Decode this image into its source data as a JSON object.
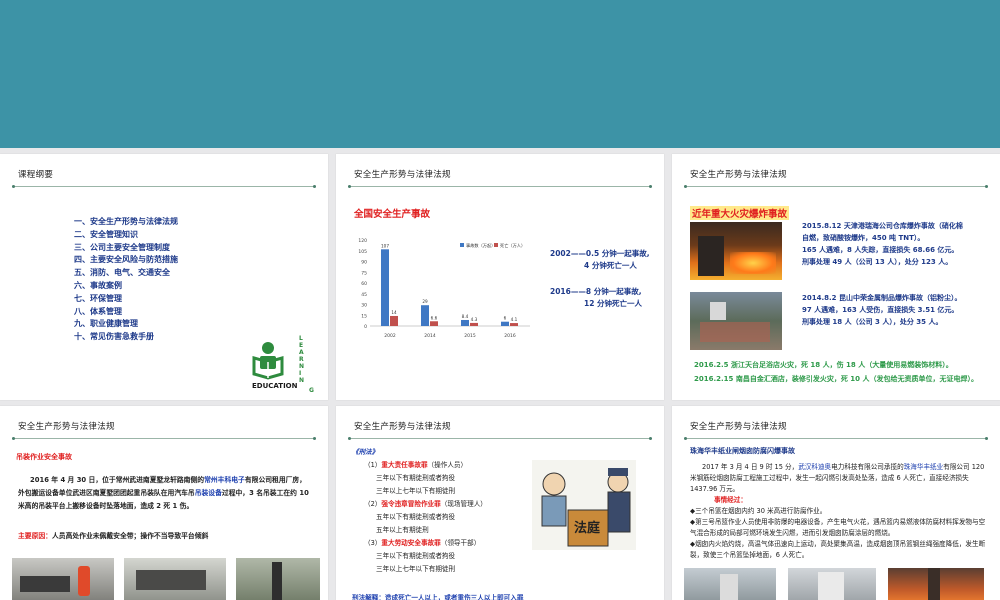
{
  "slides": {
    "toc": {
      "title": "课程纲要",
      "items": [
        "一、安全生产形势与法律法规",
        "二、安全管理知识",
        "三、公司主要安全管理制度",
        "四、主要安全风险与防范措施",
        "五、消防、电气、交通安全",
        "六、事故案例",
        "七、环保管理",
        "八、体系管理",
        "九、职业健康管理",
        "十、常见伤害急救手册"
      ],
      "logo_text": "EDUCATION",
      "logo_vertical": "LEARNING"
    },
    "national": {
      "title": "安全生产形势与法律法规",
      "heading": "全国安全生产事故",
      "stat1_line1": "2002——0.5 分钟一起事故,",
      "stat1_line2": "4 分钟死亡一人",
      "stat2_line1": "2016——8 分钟一起事故,",
      "stat2_line2": "12 分钟死亡一人"
    },
    "fire": {
      "title": "安全生产形势与法律法规",
      "heading": "近年重大火灾爆炸事故",
      "case1": [
        "2015.8.12 天津港瑞海公司仓库爆炸事故（硝化棉",
        "自燃，致硝酸铵爆炸，450 吨 TNT）。",
        "165 人遇难，8 人失踪，直接损失 68.66 亿元。",
        "刑事处理 49 人（公司 13 人），处分 123 人。"
      ],
      "case2": [
        "2014.8.2 昆山中荣金属制品爆炸事故（铝粉尘）。",
        "97 人遇难，163 人受伤，直接损失 3.51 亿元。",
        "刑事处理 18 人（公司 3 人），处分 35 人。"
      ],
      "note1": "2016.2.5 浙江天台足浴店火灾，死 18 人，伤 18 人（大量使用易燃装饰材料）。",
      "note2": "2016.2.15 南昌自金汇酒店，装修引发火灾，死 10 人（发包给无资质单位，无证电焊）。"
    },
    "crane": {
      "title": "安全生产形势与法律法规",
      "heading": "吊装作业安全事故",
      "p1_a": "2016 年 4 月 30 日，位于常州武进南夏墅龙轩路南侧的",
      "p1_company": "常州丰科电子",
      "p1_b": "有限公司租用厂房，外包搬运设备单位武进区南夏墅团团起重吊装队在用汽车吊",
      "p1_equip": "吊装设备",
      "p1_c": "过程中，3 名吊装工在约 10 米高的吊装平台上搬移设备时坠落地面，造成 2 死 1 伤。",
      "cause_label": "主要原因：",
      "cause_text": "人员高处作业未佩戴安全带；操作不当导致平台倾斜"
    },
    "law": {
      "title": "安全生产形势与法律法规",
      "book": "《刑法》",
      "c1_no": "（1）",
      "c1_name": "重大责任事故罪",
      "c1_who": "（操作人员）",
      "c1_l1": "三年以下有期徒刑或者拘役",
      "c1_l2": "三年以上七年以下有期徒刑",
      "c2_no": "（2）",
      "c2_name": "强令违章冒险作业罪",
      "c2_who": "（现场管理人）",
      "c2_l1": "五年以下有期徒刑或者拘役",
      "c2_l2": "五年以上有期徒刑",
      "c3_no": "（3）",
      "c3_name": "重大劳动安全事故罪",
      "c3_who": "（领导干部）",
      "c3_l1": "三年以下有期徒刑或者拘役",
      "c3_l2": "三年以上七年以下有期徒刑",
      "court_sign": "法庭",
      "bottom": "刑法解释：造成死亡一人以上，或者重伤三人以上即可入罪"
    },
    "zhuhai": {
      "title": "安全生产形势与法律法规",
      "heading": "珠海华丰纸业闸烟囱防腐闪爆事故",
      "p1_a": "2017 年 3 月 4 日 9 时 15 分，",
      "p1_co1": "武汉科迪奥",
      "p1_b": "电力科技有限公司承揽的",
      "p1_co2": "珠海华丰纸业",
      "p1_c": "有限公司 120 米钢筋砼烟囱防腐工程施工过程中，发生一起闪燃引发高处坠落，造成 6 人死亡，直接经济损失 1437.96 万元。",
      "cause_label": "事情经过：",
      "b1": "◆三个吊篮在烟囱内约 30 米高进行防腐作业。",
      "b2": "◆第三号吊篮作业人员使用非防爆的电器设备，产生电气火花，遇吊篮内易燃液体防腐材料挥发物与空气混合形成的局部可燃环境发生闪燃，进而引发烟囱防腐涂层的燃烧。",
      "b3": "◆烟囱内火焰灼烧，高温气体迅速向上运动，高处聚集高温，造成烟囱顶吊篮钢丝绳强度降低，发生断裂，致使三个吊篮坠掉地面，6 人死亡。"
    }
  },
  "chart_data": {
    "type": "bar",
    "categories": [
      "2002",
      "2014",
      "2015",
      "2016"
    ],
    "series": [
      {
        "name": "事故数（万起）",
        "values": [
          107,
          29,
          8.4,
          6
        ],
        "color": "#3f78c4"
      },
      {
        "name": "死亡（万人）",
        "values": [
          14,
          6.6,
          4.3,
          4.1
        ],
        "color": "#c0504d"
      }
    ],
    "ylim": [
      0,
      120
    ],
    "yticks": [
      0,
      15,
      30,
      45,
      60,
      75,
      90,
      105,
      120
    ],
    "legend": "top-right",
    "grid": false
  }
}
